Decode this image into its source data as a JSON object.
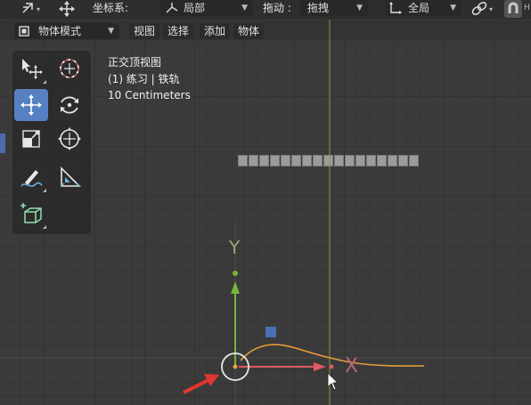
{
  "header": {
    "coord_label": "坐标系:",
    "coord_value": "局部",
    "drag_label": "拖动 :",
    "drag_value": "拖拽",
    "pivot_value": "全局",
    "right_cut": "H"
  },
  "viewport_header": {
    "mode": "物体模式",
    "menus": [
      "视图",
      "选择",
      "添加",
      "物体"
    ]
  },
  "overlay": {
    "view_name": "正交顶视图",
    "object": "(1) 练习 | 铁轨",
    "scale": "10 Centimeters"
  },
  "gizmo": {
    "x_label": "X",
    "y_label": "Y"
  },
  "colors": {
    "active_tool": "#5680c2",
    "x_axis": "#e05a63",
    "y_axis": "#79b339",
    "curve": "#e89b3a",
    "vertical_line": "#8e9a3c",
    "selected_square": "#4a6fb5"
  },
  "tools": [
    {
      "name": "select-tool-icon"
    },
    {
      "name": "cursor-tool-icon"
    },
    {
      "name": "move-tool-icon",
      "active": true
    },
    {
      "name": "rotate-tool-icon"
    },
    {
      "name": "scale-tool-icon"
    },
    {
      "name": "transform-tool-icon"
    },
    {
      "name": "annotate-tool-icon"
    },
    {
      "name": "measure-tool-icon"
    },
    {
      "name": "add-cube-tool-icon"
    }
  ]
}
